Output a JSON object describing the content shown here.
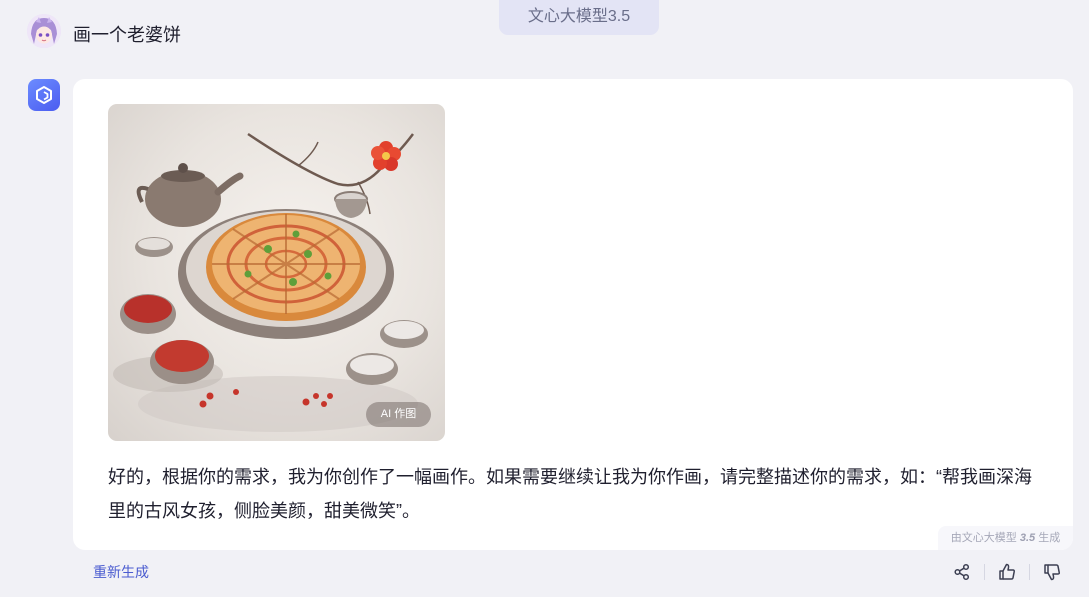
{
  "header": {
    "model_label": "文心大模型3.5"
  },
  "user": {
    "query": "画一个老婆饼"
  },
  "answer": {
    "image_badge": "AI 作图",
    "text": "好的，根据你的需求，我为你创作了一幅画作。如果需要继续让我为你作画，请完整描述你的需求，如：“帮我画深海里的古风女孩，侧脸美颜，甜美微笑”。",
    "watermark_prefix": "由文心大模型",
    "watermark_version": "3.5",
    "watermark_suffix": "生成"
  },
  "footer": {
    "regenerate_label": "重新生成",
    "icons": [
      "share-icon",
      "thumbs-up-icon",
      "thumbs-down-icon"
    ]
  },
  "colors": {
    "accent": "#4b5cd0",
    "background": "#f1f1f6",
    "card": "#ffffff"
  }
}
